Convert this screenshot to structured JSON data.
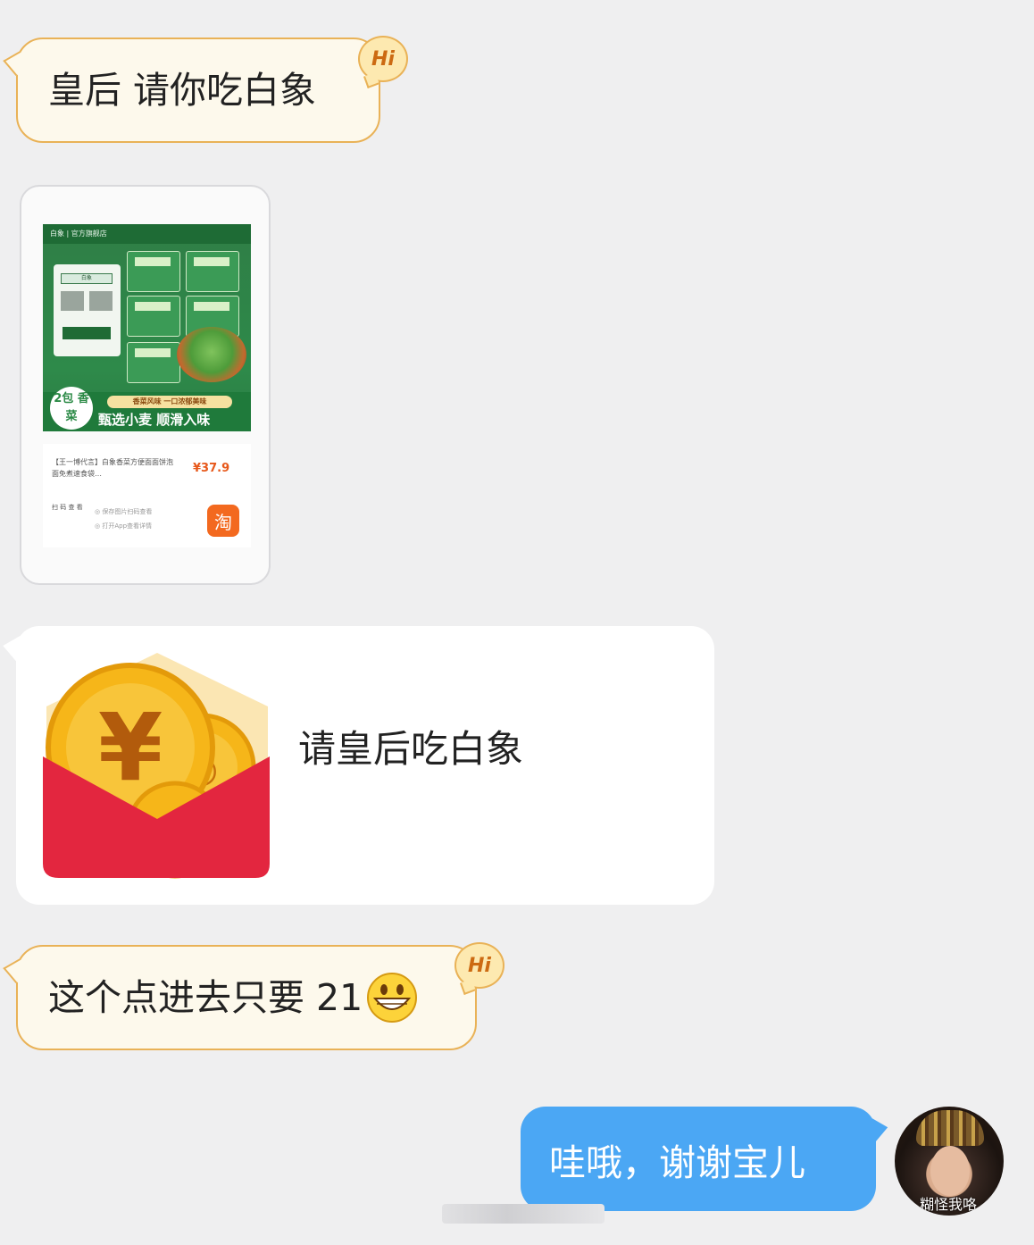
{
  "messages": {
    "m1": {
      "text": "皇后 请你吃白象",
      "badge": "Hi"
    },
    "product": {
      "shop": "白象 | 官方旗舰店",
      "badge": "2包 香菜",
      "slogan_pill": "香菜风味 一口浓郁美味",
      "slogan": "甄选小麦 顺滑入味",
      "title": "【王一博代言】白象香菜方便面面饼泡面免煮速食袋…",
      "price": "¥37.9",
      "qr_text": "扫 码 查 看",
      "hint_1": "◎ 保存图片扫码查看",
      "hint_2": "◎ 打开App查看详情",
      "app_icon": "淘"
    },
    "redpacket": {
      "label": "请皇后吃白象"
    },
    "m3": {
      "text": "这个点进去只要 21",
      "emoji": "grinning-face",
      "badge": "Hi"
    },
    "m4": {
      "text": "哇哦，谢谢宝儿"
    }
  },
  "avatar": {
    "watermark": "糊怪我咯"
  },
  "colors": {
    "background": "#efeff0",
    "bubble_border": "#e9b257",
    "bubble_fill": "#fdf9ec",
    "outgoing": "#4ba7f4",
    "redpacket_red": "#e3263f",
    "coin": "#f6b619"
  }
}
